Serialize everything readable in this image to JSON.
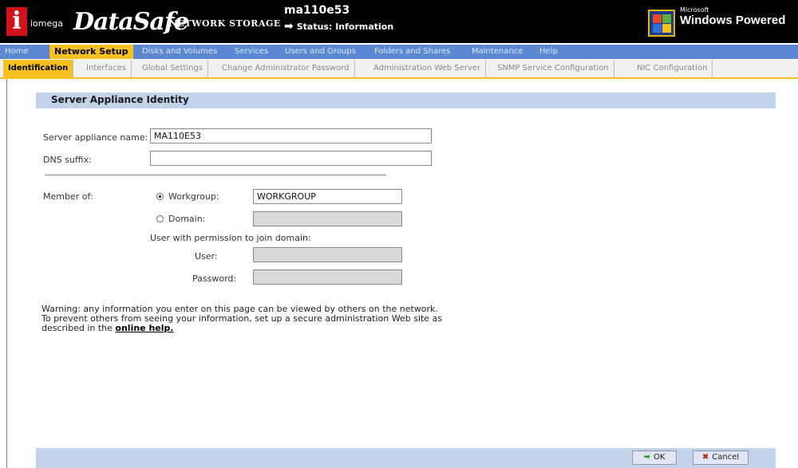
{
  "header": {
    "logo_word": "iomega",
    "brand": "DataSafe",
    "brand_sub": "NETWORK STORAGE",
    "host": "ma110e53",
    "status": "Status: Information",
    "windows_small": "Microsoft",
    "windows_text": "Windows Powered"
  },
  "main_menu": [
    "Home",
    "Network Setup",
    "Disks and Volumes",
    "Services",
    "Users and Groups",
    "Folders and Shares",
    "Maintenance",
    "Help"
  ],
  "sub_menu": [
    "Identification",
    "Interfaces",
    "Global Settings",
    "Change Administrator Password",
    "Administration Web Server",
    "SNMP Service Configuration",
    "NIC Configuration"
  ],
  "section": {
    "title": "Server Appliance Identity"
  },
  "form": {
    "server_name_label": "Server appliance name:",
    "server_name_value": "MA110E53",
    "dns_label": "DNS suffix:",
    "dns_value": "",
    "member_of_label": "Member of:",
    "workgroup_label": "Workgroup:",
    "workgroup_value": "WORKGROUP",
    "domain_label": "Domain:",
    "domain_value": "",
    "join_label": "User with permission to join domain:",
    "user_label": "User:",
    "password_label": "Password:"
  },
  "warning": {
    "line1": "Warning: any information you enter on this page can be viewed by others on the network.",
    "line2": "To prevent others from seeing your information, set up a secure administration Web site as",
    "line3": "described in the",
    "link": "online help."
  },
  "buttons": {
    "ok": "OK",
    "cancel": "Cancel"
  },
  "colors": {
    "menu_blue": "#5b88d0",
    "active_tab": "#f7c020",
    "section_bar": "#c3d3ea"
  }
}
